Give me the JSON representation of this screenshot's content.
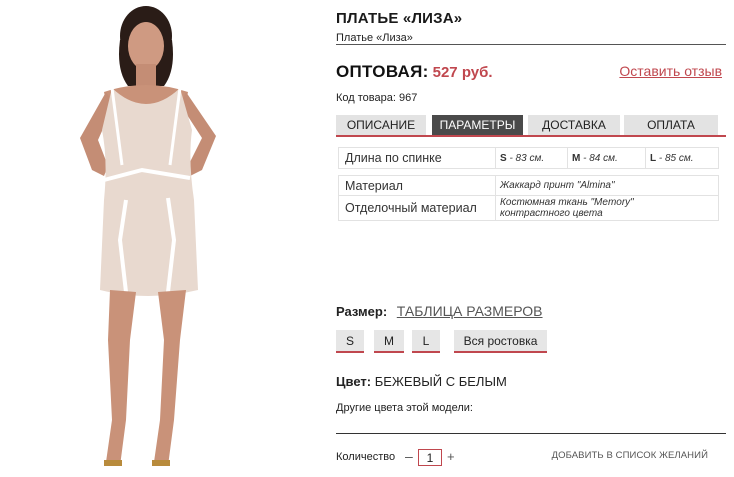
{
  "product": {
    "title": "ПЛАТЬЕ «ЛИЗА»",
    "subtitle": "Платье «Лиза»",
    "price_label": "ОПТОВАЯ:",
    "price_value": "527 руб.",
    "review_link": "Оставить отзыв",
    "sku": "Код товара: 967"
  },
  "tabs": [
    {
      "label": "ОПИСАНИЕ",
      "active": false
    },
    {
      "label": "ПАРАМЕТРЫ",
      "active": true
    },
    {
      "label": "ДОСТАВКА",
      "active": false
    },
    {
      "label": "ОПЛАТА",
      "active": false
    }
  ],
  "params": {
    "length": {
      "label": "Длина по спинке",
      "s_size": "S",
      "s_value": " - 83 см.",
      "m_size": "M",
      "m_value": " - 84 см.",
      "l_size": "L",
      "l_value": " - 85 см."
    },
    "material": {
      "label": "Материал",
      "value": "Жаккард принт \"Almina\""
    },
    "trim": {
      "label": "Отделочный материал",
      "value": "Костюмная ткань \"Memory\" контрастного цвета"
    }
  },
  "size": {
    "label": "Размер:",
    "table_link": "ТАБЛИЦА РАЗМЕРОВ",
    "options": [
      "S",
      "M",
      "L",
      "Вся ростовка"
    ]
  },
  "color": {
    "label": "Цвет:",
    "value": "БЕЖЕВЫЙ С БЕЛЫМ",
    "other_colors": "Другие цвета этой модели:"
  },
  "quantity": {
    "label": "Количество",
    "minus": "–",
    "value": "1",
    "plus": "+"
  },
  "wishlist": "ДОБАВИТЬ В СПИСОК ЖЕЛАНИЙ",
  "colors": {
    "accent": "#c0474e",
    "active_tab": "#4a4a4a",
    "tab_bg": "#e3e3e3",
    "dress": "#e8d9cf",
    "dress_trim": "#ffffff",
    "skin": "#c9917a"
  }
}
